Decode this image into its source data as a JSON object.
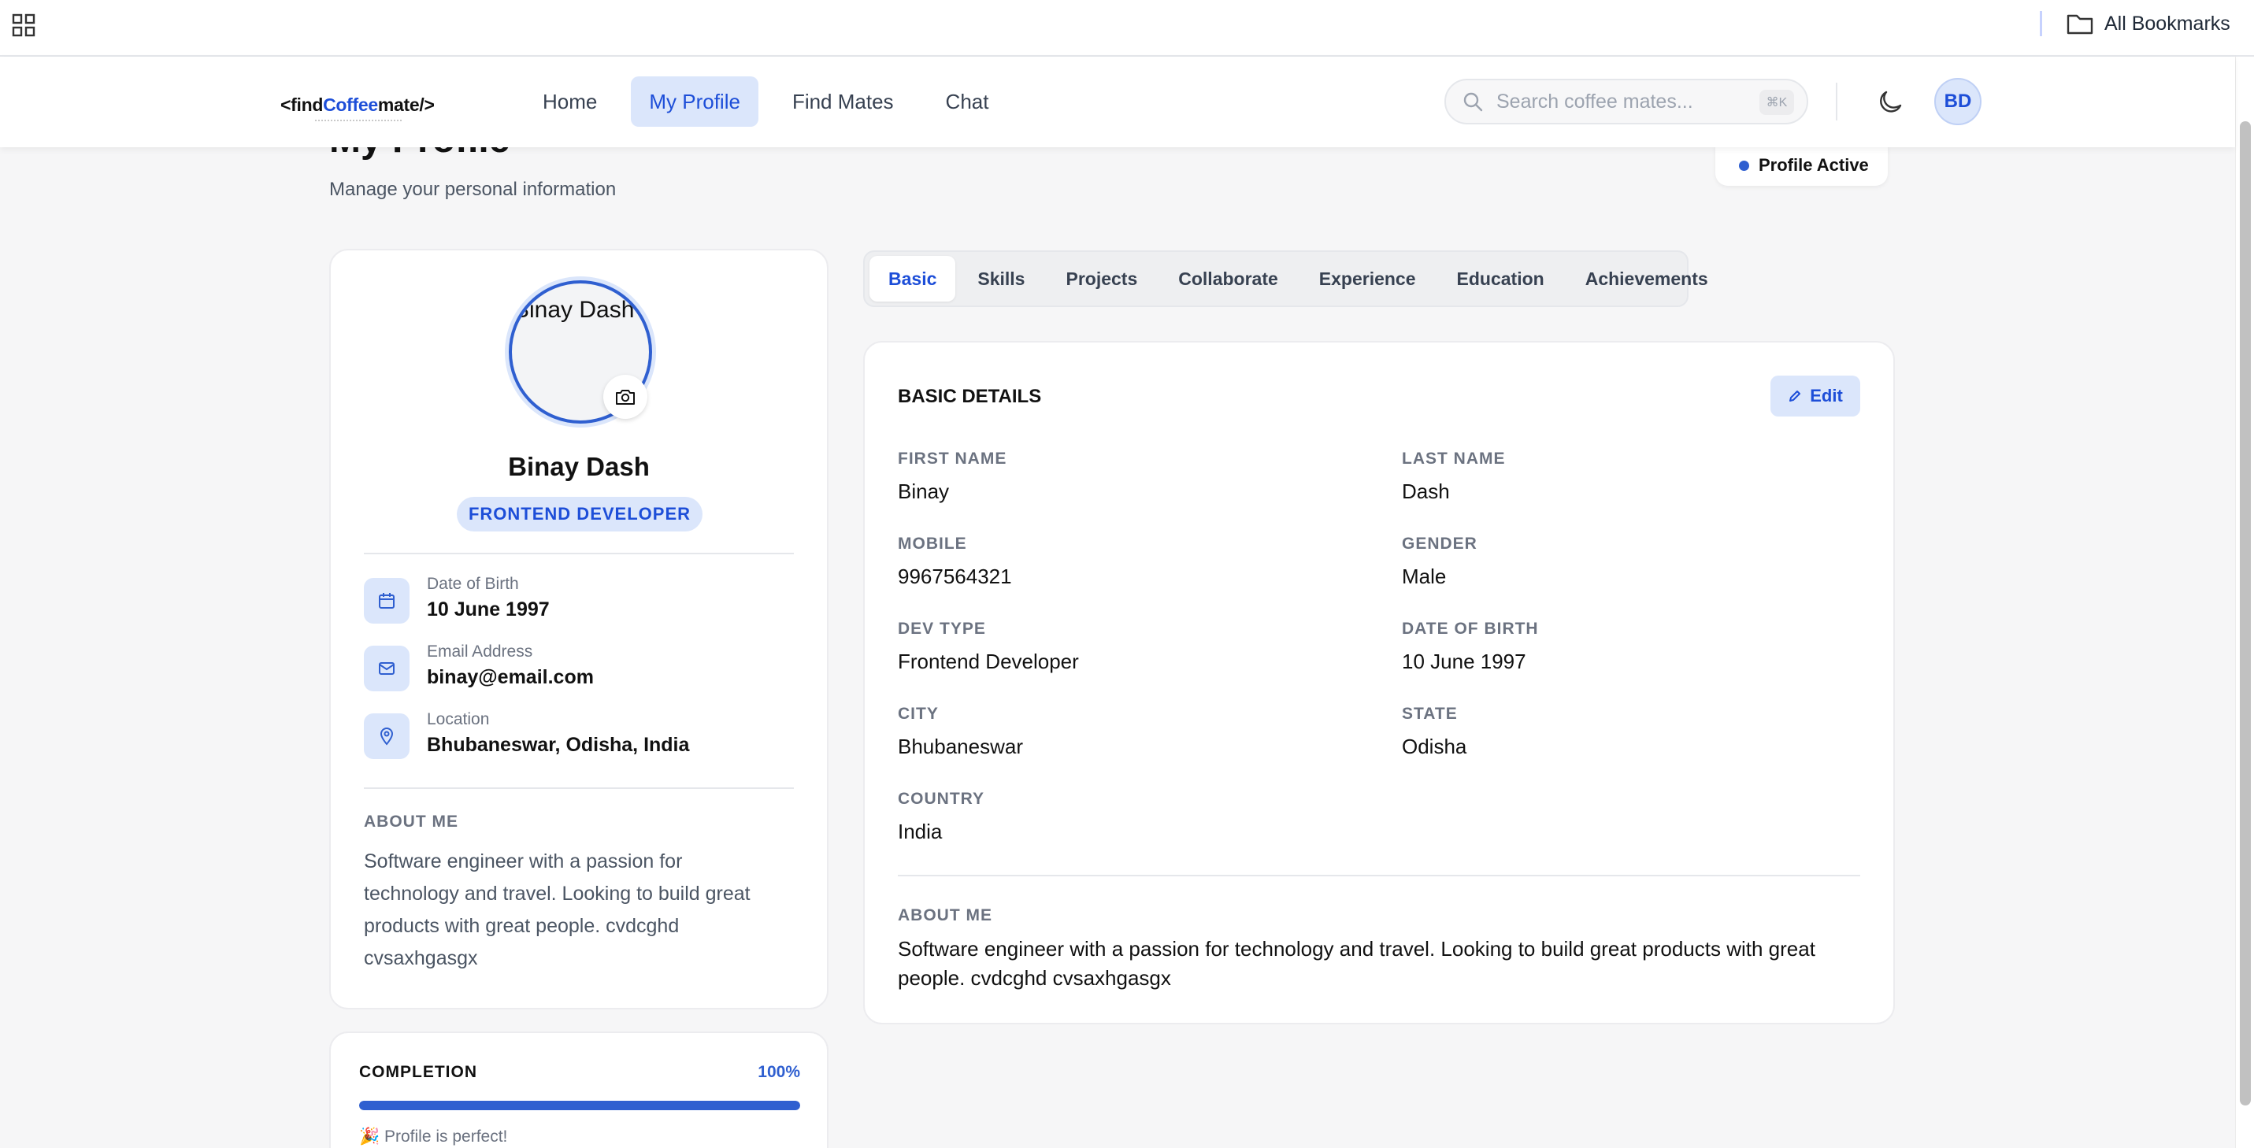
{
  "browser": {
    "all_bookmarks_label": "All Bookmarks"
  },
  "header": {
    "logo_prefix": "<find",
    "logo_brand": "Coffee",
    "logo_suffix": "mate/>",
    "nav": [
      {
        "label": "Home",
        "active": false
      },
      {
        "label": "My Profile",
        "active": true
      },
      {
        "label": "Find Mates",
        "active": false
      },
      {
        "label": "Chat",
        "active": false
      }
    ],
    "search_placeholder": "Search coffee mates...",
    "search_shortcut": "⌘K",
    "user_initials": "BD"
  },
  "page": {
    "title": "My Profile",
    "subtitle": "Manage your personal information",
    "status": "Profile Active"
  },
  "profile": {
    "photo_alt": "Binay Dash",
    "name": "Binay Dash",
    "role": "FRONTEND DEVELOPER",
    "info": [
      {
        "label": "Date of Birth",
        "value": "10 June 1997",
        "icon": "calendar-icon"
      },
      {
        "label": "Email Address",
        "value": "binay@email.com",
        "icon": "mail-icon"
      },
      {
        "label": "Location",
        "value": "Bhubaneswar, Odisha, India",
        "icon": "map-pin-icon"
      }
    ],
    "about_label": "ABOUT ME",
    "about": "Software engineer with a passion for technology and travel. Looking to build great products with great people. cvdcghd cvsaxhgasgx"
  },
  "completion": {
    "title": "COMPLETION",
    "percent_label": "100%",
    "percent": 100,
    "message": "🎉 Profile is perfect!"
  },
  "tabs": [
    {
      "label": "Basic",
      "active": true
    },
    {
      "label": "Skills",
      "active": false
    },
    {
      "label": "Projects",
      "active": false
    },
    {
      "label": "Collaborate",
      "active": false
    },
    {
      "label": "Experience",
      "active": false
    },
    {
      "label": "Education",
      "active": false
    },
    {
      "label": "Achievements",
      "active": false
    }
  ],
  "details": {
    "title": "BASIC DETAILS",
    "edit_label": "Edit",
    "fields": {
      "first_name": {
        "label": "FIRST NAME",
        "value": "Binay"
      },
      "last_name": {
        "label": "LAST NAME",
        "value": "Dash"
      },
      "mobile": {
        "label": "MOBILE",
        "value": "9967564321"
      },
      "gender": {
        "label": "GENDER",
        "value": "Male"
      },
      "dev_type": {
        "label": "DEV TYPE",
        "value": "Frontend Developer"
      },
      "dob": {
        "label": "DATE OF BIRTH",
        "value": "10 June 1997"
      },
      "city": {
        "label": "CITY",
        "value": "Bhubaneswar"
      },
      "state": {
        "label": "STATE",
        "value": "Odisha"
      },
      "country": {
        "label": "COUNTRY",
        "value": "India"
      }
    },
    "about_label": "ABOUT ME",
    "about": "Software engineer with a passion for technology and travel. Looking to build great products with great people. cvdcghd cvsaxhgasgx"
  },
  "colors": {
    "accent": "#2f5fd0",
    "accent_soft": "#dbe6fb",
    "page_bg": "#f6f6f7"
  }
}
